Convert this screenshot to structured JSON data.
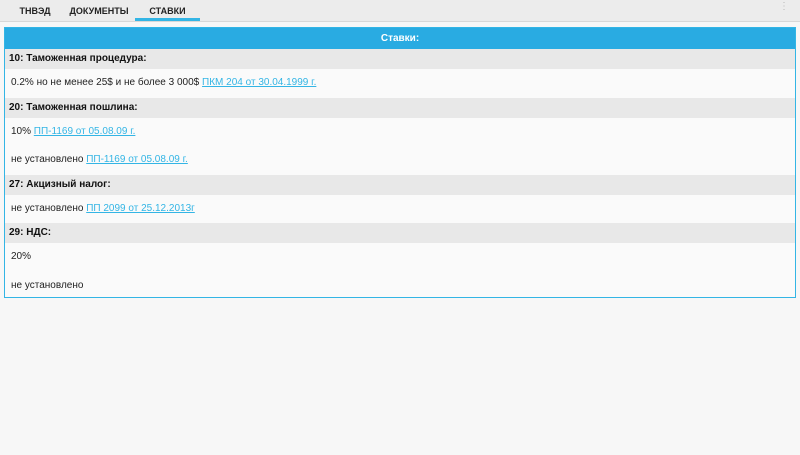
{
  "tabs": [
    {
      "label": "ТНВЭД"
    },
    {
      "label": "ДОКУМЕНТЫ"
    },
    {
      "label": "СТАВКИ"
    }
  ],
  "card_title": "Ставки:",
  "sections": [
    {
      "title": "10: Таможенная процедура:",
      "rows": [
        {
          "text": "0.2% но не менее 25$ и не более 3 000$",
          "link": "ПКМ 204 от 30.04.1999 г."
        }
      ]
    },
    {
      "title": "20: Таможенная пошлина:",
      "rows": [
        {
          "text": "10%",
          "link": "ПП-1169 от 05.08.09 г."
        },
        {
          "text": "не установлено",
          "link": "ПП-1169 от 05.08.09 г."
        }
      ]
    },
    {
      "title": "27: Акцизный налог:",
      "rows": [
        {
          "text": "не установлено",
          "link": "ПП 2099 от 25.12.2013г"
        }
      ]
    },
    {
      "title": "29: НДС:",
      "rows": [
        {
          "text": "20%"
        },
        {
          "text": "не установлено"
        }
      ]
    }
  ]
}
